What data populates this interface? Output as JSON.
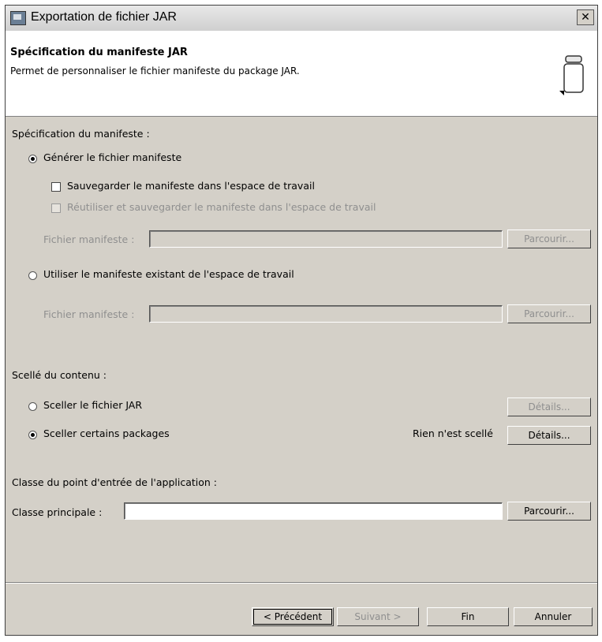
{
  "window": {
    "title": "Exportation de fichier JAR",
    "close_glyph": "✕"
  },
  "banner": {
    "title": "Spécification du manifeste JAR",
    "description": "Permet de personnaliser le fichier manifeste du package JAR."
  },
  "manifest": {
    "section_label": "Spécification du manifeste :",
    "generate_label": "Générer le fichier manifeste",
    "save_label": "Sauvegarder le manifeste dans l'espace de travail",
    "reuse_label": "Réutiliser et sauvegarder le manifeste dans l'espace de travail",
    "file_label_1": "Fichier manifeste :",
    "file_value_1": "",
    "browse_1": "Parcourir...",
    "use_existing_label": "Utiliser le manifeste existant de l'espace de travail",
    "file_label_2": "Fichier manifeste :",
    "file_value_2": "",
    "browse_2": "Parcourir..."
  },
  "sealing": {
    "section_label": "Scellé du contenu :",
    "seal_jar_label": "Sceller le fichier JAR",
    "details_1": "Détails...",
    "seal_packages_label": "Sceller certains packages",
    "status": "Rien n'est scellé",
    "details_2": "Détails..."
  },
  "entry_point": {
    "section_label": "Classe du point d'entrée de l'application :",
    "main_class_label": "Classe principale :",
    "main_class_value": "",
    "browse": "Parcourir..."
  },
  "footer": {
    "back": "< Précédent",
    "next": "Suivant >",
    "finish": "Fin",
    "cancel": "Annuler"
  }
}
